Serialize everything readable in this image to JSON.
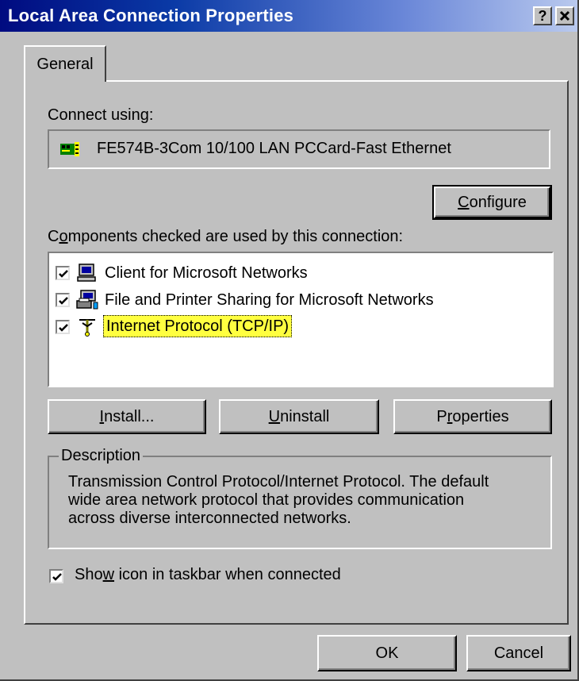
{
  "window": {
    "title": "Local Area Connection Properties",
    "help_button": "?",
    "close_button": "×",
    "titlebar_colors": [
      "#000b80",
      "#b9c9ee"
    ]
  },
  "tabs": [
    {
      "label": "General",
      "active": true
    }
  ],
  "connect_using": {
    "label": "Connect using:",
    "adapter": "FE574B-3Com 10/100 LAN PCCard-Fast Ethernet",
    "adapter_icon": "network-card-icon"
  },
  "buttons": {
    "configure": {
      "prefix": "",
      "mnemonic": "C",
      "rest": "onfigure"
    },
    "install": {
      "prefix": "",
      "mnemonic": "I",
      "rest": "nstall..."
    },
    "uninstall": {
      "prefix": "",
      "mnemonic": "U",
      "rest": "ninstall"
    },
    "properties": {
      "prefix": "P",
      "mnemonic": "r",
      "rest": "operties"
    },
    "ok": "OK",
    "cancel": "Cancel"
  },
  "components": {
    "label_prefix": "C",
    "label_mnemonic": "o",
    "label_rest": "mponents checked are used by this connection:",
    "items": [
      {
        "label": "Client for Microsoft Networks",
        "checked": true,
        "icon": "network-client-icon",
        "selected": false
      },
      {
        "label": "File and Printer Sharing for Microsoft Networks",
        "checked": true,
        "icon": "file-printer-sharing-icon",
        "selected": false
      },
      {
        "label": "Internet Protocol (TCP/IP)",
        "checked": true,
        "icon": "protocol-icon",
        "selected": true
      }
    ]
  },
  "description": {
    "legend": "Description",
    "lines": [
      "Transmission Control Protocol/Internet Protocol. The default",
      "wide area network protocol that provides communication",
      "across diverse interconnected networks."
    ]
  },
  "taskbar_option": {
    "checked": true,
    "prefix": "Sho",
    "mnemonic": "w",
    "rest": " icon in taskbar when connected"
  },
  "colors": {
    "face": "#c0c0c0",
    "highlight": "#ffff40"
  }
}
